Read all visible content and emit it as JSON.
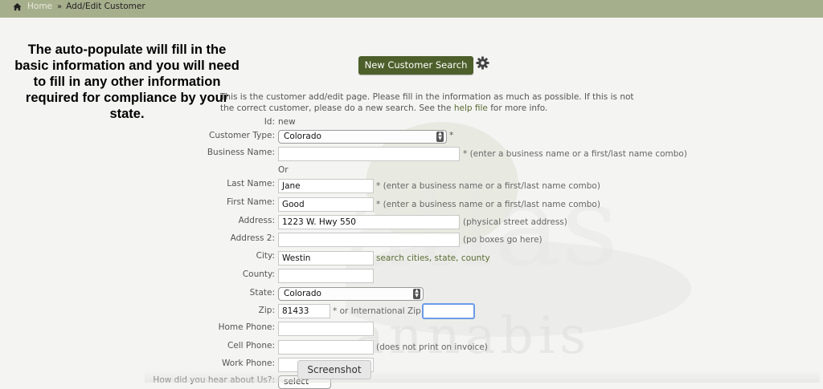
{
  "breadcrumb": {
    "home": "Home",
    "current": "Add/Edit Customer"
  },
  "annotation": "The auto-populate will fill in the basic information and you will need to fill in any other information required for compliance by your state.",
  "toolbar": {
    "new_search_label": "New Customer Search"
  },
  "intro": {
    "before_link": "This is the customer add/edit page. Please fill in the information as much as possible. If this is not the correct customer, please do a new search. See the ",
    "link": "help file",
    "after_link": " for more info."
  },
  "form": {
    "id_label": "Id:",
    "id_value": "new",
    "customer_type_label": "Customer Type:",
    "customer_type_value": "Colorado",
    "required": "*",
    "business_name_label": "Business Name:",
    "business_name_value": "",
    "name_hint": "* (enter a business name or a first/last name combo)",
    "or_text": "Or",
    "last_name_label": "Last Name:",
    "last_name_value": "Jane",
    "first_name_label": "First Name:",
    "first_name_value": "Good",
    "address_label": "Address:",
    "address_value": "1223 W. Hwy 550",
    "address_hint": "(physical street address)",
    "address2_label": "Address 2:",
    "address2_value": "",
    "address2_hint": "(po boxes go here)",
    "city_label": "City:",
    "city_value": "Westin",
    "city_link": "search cities, state, county",
    "county_label": "County:",
    "county_value": "",
    "state_label": "State:",
    "state_value": "Colorado",
    "zip_label": "Zip:",
    "zip_value": "81433",
    "intl_zip_label": "* or International Zip:",
    "intl_zip_value": "",
    "home_phone_label": "Home Phone:",
    "home_phone_value": "",
    "cell_phone_label": "Cell Phone:",
    "cell_phone_value": "",
    "cell_phone_hint": "(does not print on invoice)",
    "work_phone_label": "Work Phone:",
    "work_phone_value": "",
    "hear_about_label": "How did you hear about Us?:",
    "hear_about_value": "select"
  },
  "tooltip": "Screenshot",
  "watermark": {
    "text1": "atlas",
    "text2": "annabis"
  },
  "colors": {
    "topbar": "#a6af8c",
    "button": "#4d5f2a",
    "link": "#5a6b33",
    "focus": "#6b9be6"
  }
}
